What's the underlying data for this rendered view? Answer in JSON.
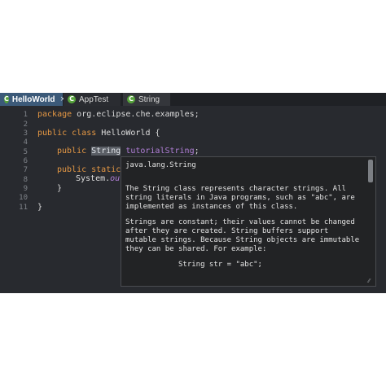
{
  "tabs": [
    {
      "icon": "C",
      "label": "HelloWorld",
      "close": "×",
      "active": true
    },
    {
      "icon": "C",
      "label": "AppTest",
      "active": false
    },
    {
      "icon": "C",
      "label": "String",
      "active": false
    }
  ],
  "line_numbers": [
    "1",
    "2",
    "3",
    "4",
    "5",
    "6",
    "7",
    "8",
    "9",
    "10",
    "11"
  ],
  "code": {
    "l1_kw": "package",
    "l1_rest": " org.eclipse.che.examples;",
    "l3_kw": "public class",
    "l3_rest": " HelloWorld {",
    "l5_kw": "public",
    "l5_type": "String",
    "l5_field": "tutorialString",
    "l5_end": ";",
    "l7_kw": "public static",
    "l8_a": "System.",
    "l8_b": "ou",
    "l9": "}",
    "l11": "}"
  },
  "popup": {
    "title": "java.lang.String",
    "p1_1": "The String class represents character strings. All",
    "p1_2": "string literals in Java programs, such as \"abc\", are",
    "p1_3": "implemented as instances of this class.",
    "p2_1": "Strings are constant; their values cannot be changed",
    "p2_2": "after they are created. String buffers support",
    "p2_3": "mutable strings. Because String objects are immutable",
    "p2_4": "they can be shared. For example:",
    "example": "String str = \"abc\";",
    "resize_icon": "⁄⁄"
  },
  "colors": {
    "background": "#282a2f",
    "active_tab": "#3c5a79",
    "keyword": "#e59844",
    "field": "#b17fd7"
  }
}
